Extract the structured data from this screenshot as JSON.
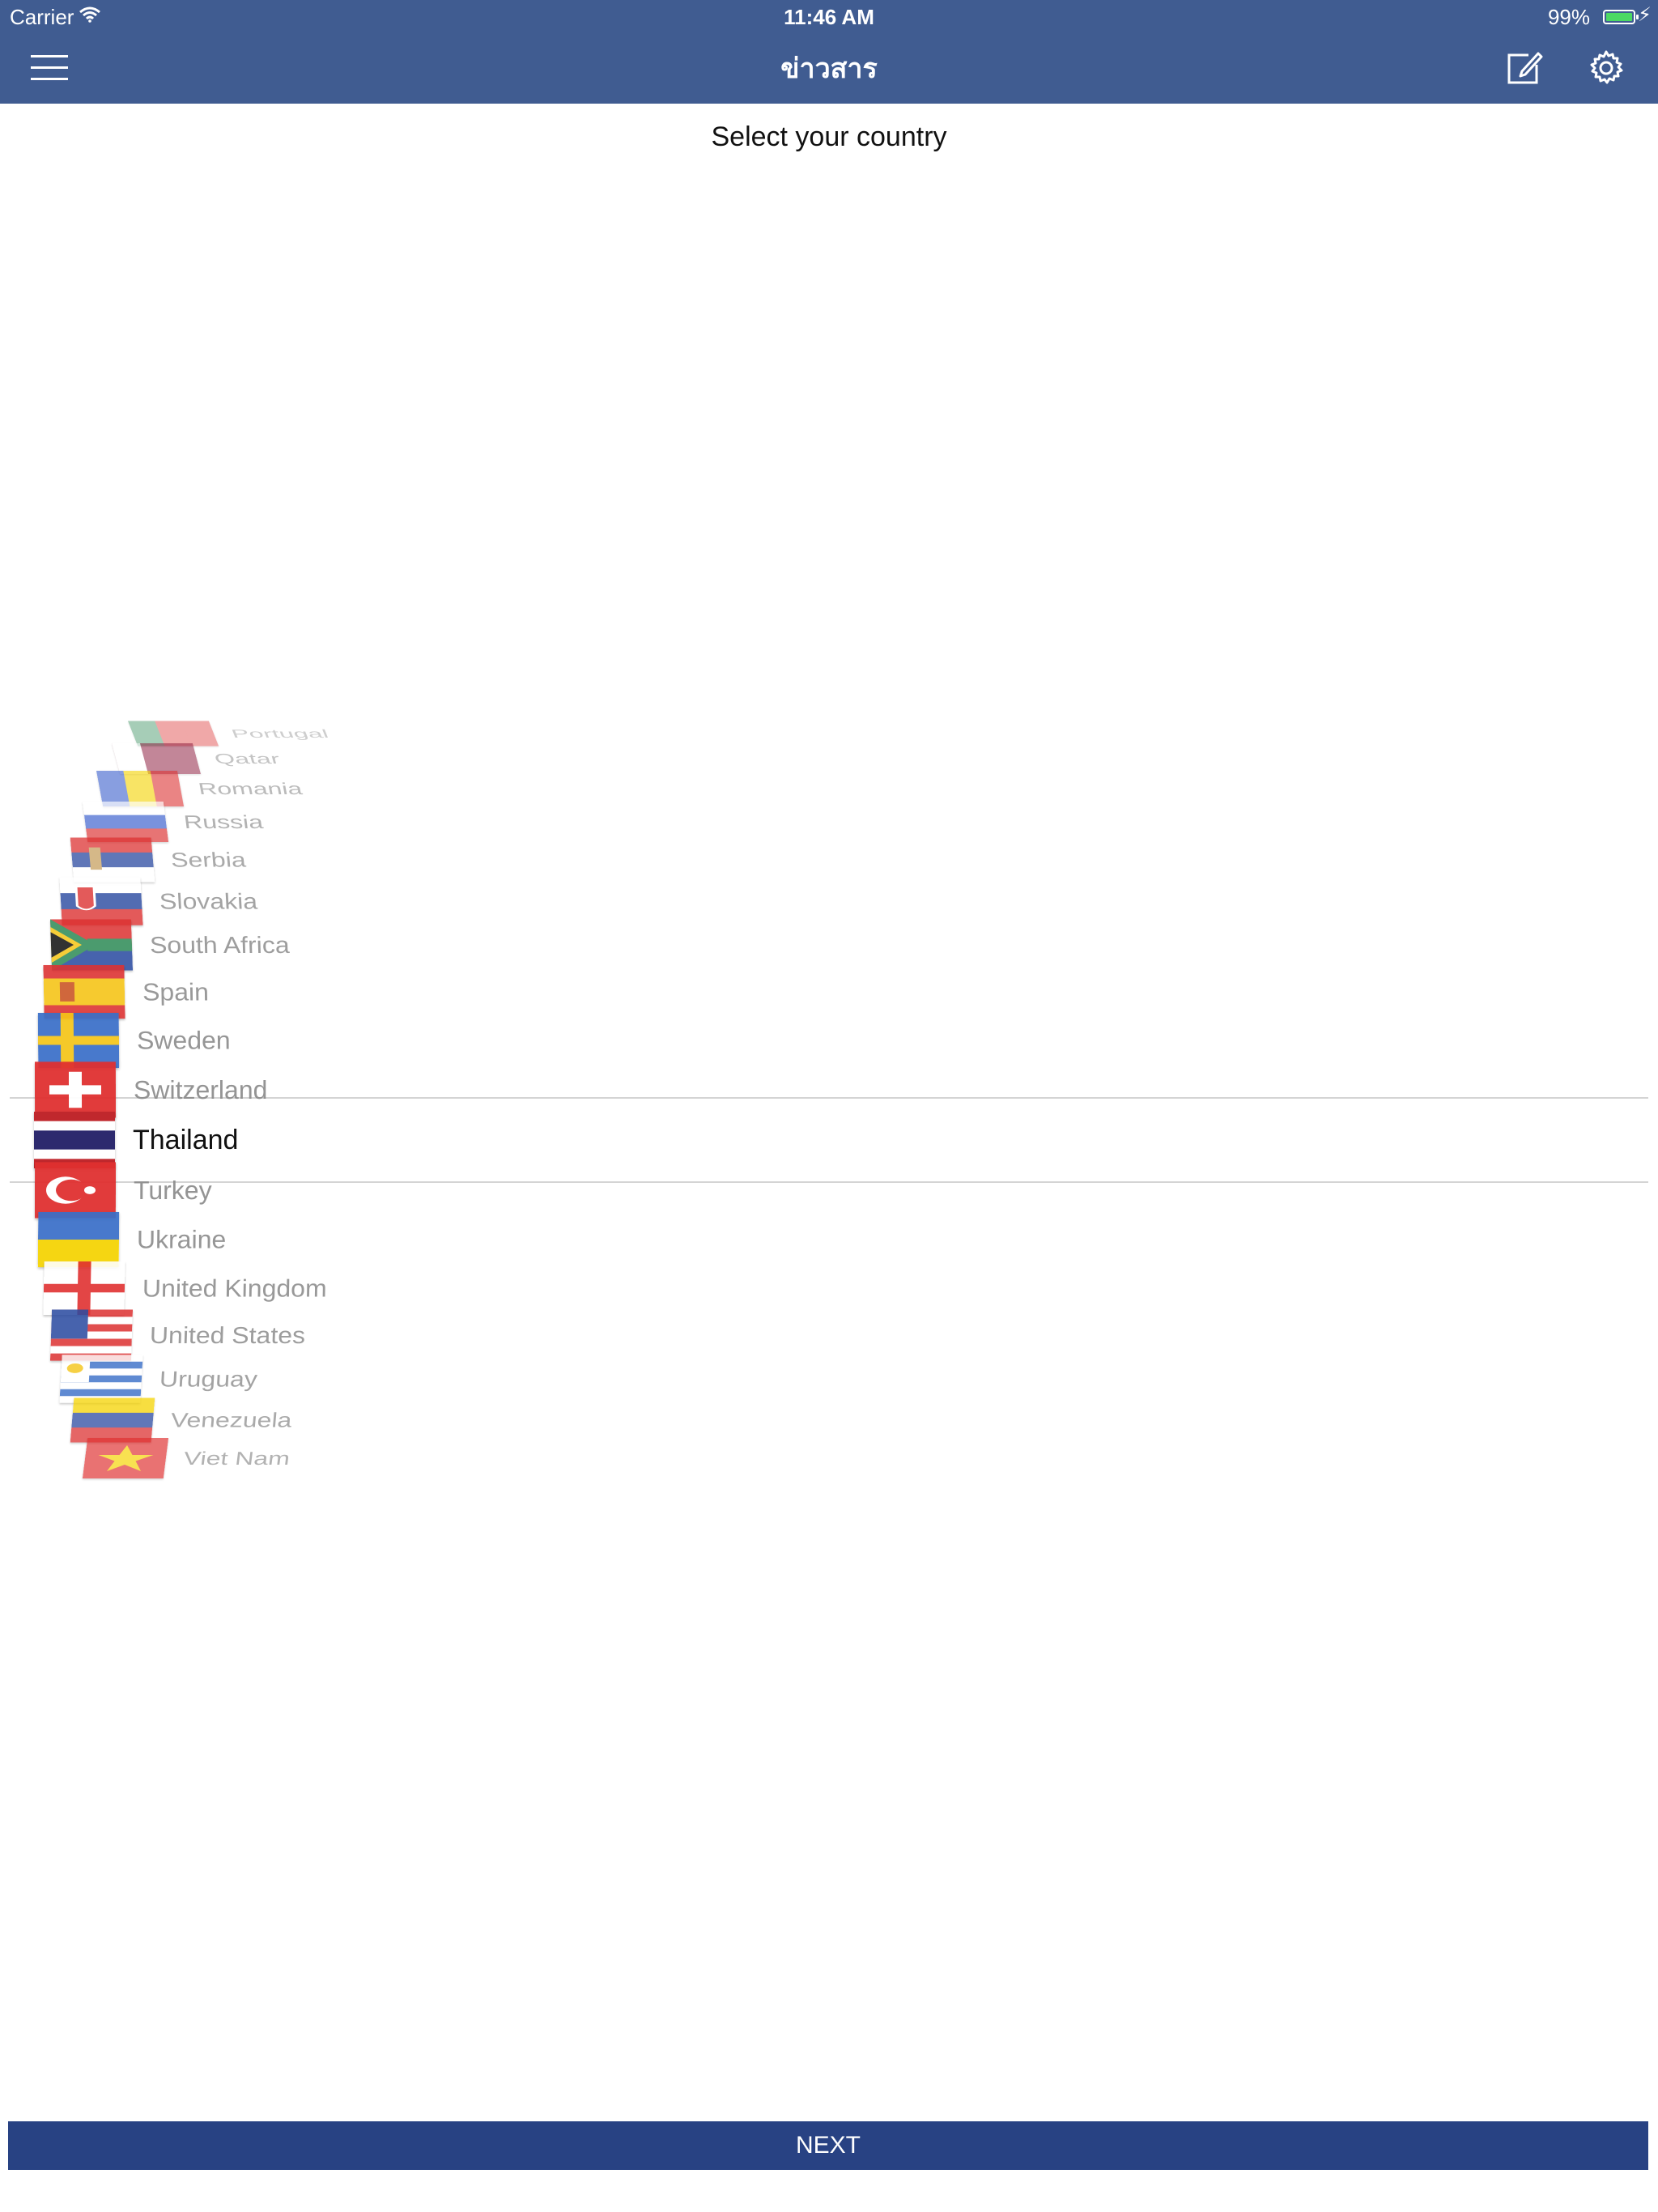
{
  "status_bar": {
    "carrier": "Carrier",
    "time": "11:46 AM",
    "battery_percent": "99%",
    "battery_level": 0.99
  },
  "nav_bar": {
    "title": "ข่าวสาร",
    "left_icon": "hamburger-menu-icon",
    "right_icons": [
      "compose-icon",
      "gear-icon"
    ],
    "background_color": "#405c91"
  },
  "heading": "Select your country",
  "countries": [
    {
      "name": "Portugal"
    },
    {
      "name": "Qatar"
    },
    {
      "name": "Romania"
    },
    {
      "name": "Russia"
    },
    {
      "name": "Serbia"
    },
    {
      "name": "Slovakia"
    },
    {
      "name": "South Africa"
    },
    {
      "name": "Spain"
    },
    {
      "name": "Sweden"
    },
    {
      "name": "Switzerland"
    },
    {
      "name": "Thailand"
    },
    {
      "name": "Turkey"
    },
    {
      "name": "Ukraine"
    },
    {
      "name": "United Kingdom"
    },
    {
      "name": "United States"
    },
    {
      "name": "Uruguay"
    },
    {
      "name": "Venezuela"
    },
    {
      "name": "Viet Nam"
    }
  ],
  "selected_country": "Thailand",
  "next_button": {
    "label": "NEXT",
    "background_color": "#284283"
  }
}
